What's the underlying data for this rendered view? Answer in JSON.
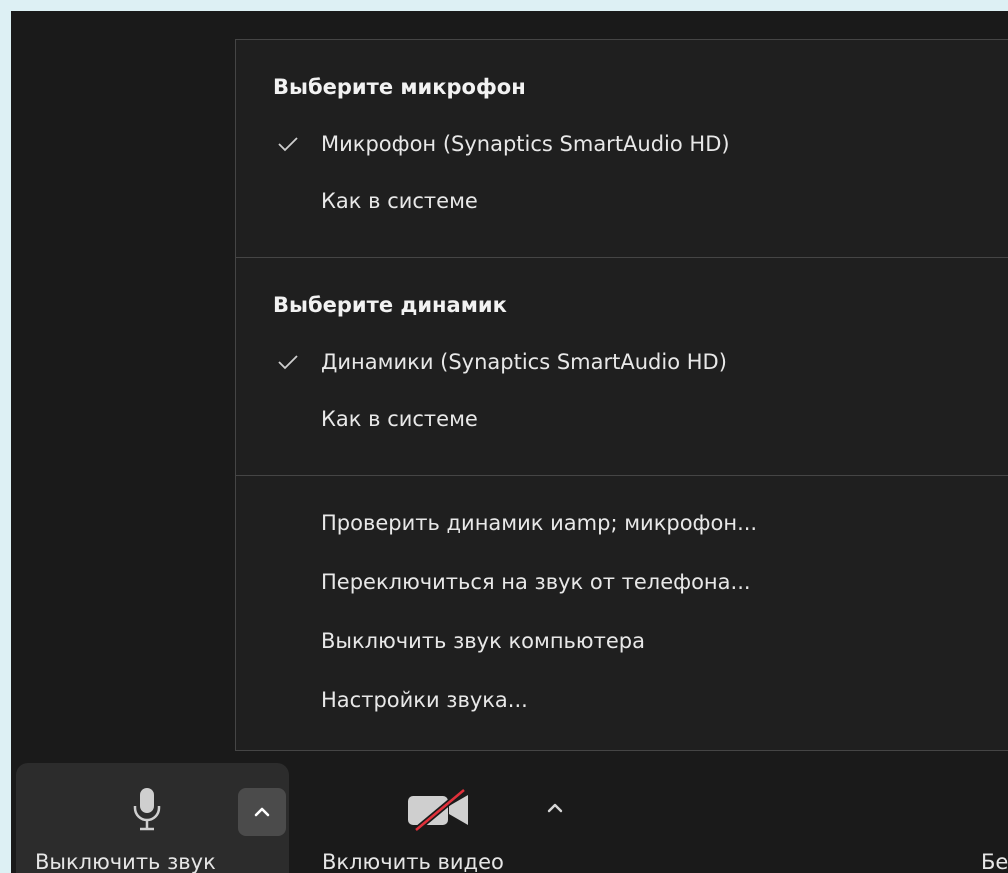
{
  "menu": {
    "mic_heading": "Выберите микрофон",
    "mic_items": [
      {
        "label": "Микрофон (Synaptics SmartAudio HD)",
        "checked": true
      },
      {
        "label": "Как в системе",
        "checked": false
      }
    ],
    "speaker_heading": "Выберите динамик",
    "speaker_items": [
      {
        "label": "Динамики (Synaptics SmartAudio HD)",
        "checked": true
      },
      {
        "label": "Как в системе",
        "checked": false
      }
    ],
    "options": [
      {
        "label": "Проверить динамик иamp; микрофон..."
      },
      {
        "label": "Переключиться на звук от телефона..."
      },
      {
        "label": "Выключить звук компьютера"
      },
      {
        "label": "Настройки звука..."
      }
    ]
  },
  "toolbar": {
    "mute_label": "Выключить звук",
    "video_label": "Включить видео",
    "cut_label": "Бе"
  },
  "icons": {
    "check": "check-icon",
    "microphone": "microphone-icon",
    "video_off": "video-off-icon",
    "chevron_up": "chevron-up-icon"
  },
  "colors": {
    "window_bg": "#1a1a1a",
    "menu_bg": "#1f1f1f",
    "outer_bg": "#ddf0f4",
    "text": "#e8e8e8",
    "video_slash": "#e0303a"
  }
}
